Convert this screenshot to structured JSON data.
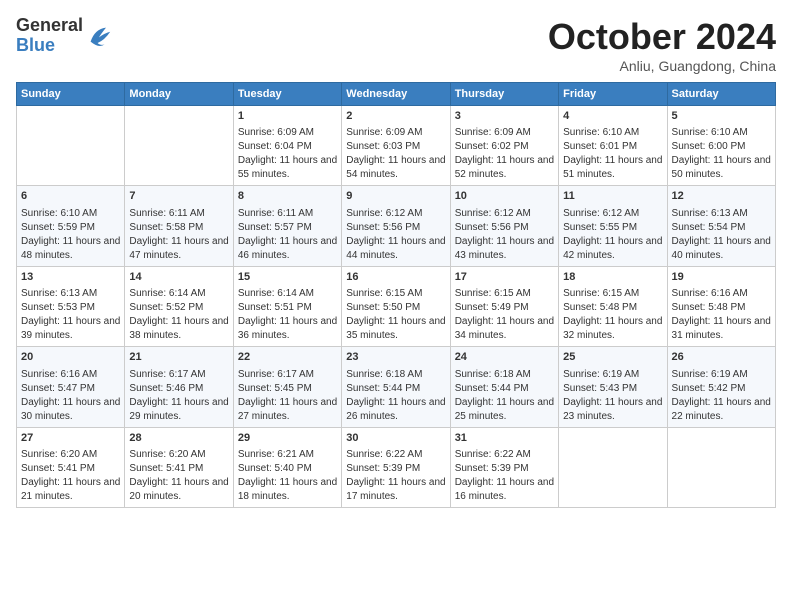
{
  "header": {
    "title": "October 2024",
    "location": "Anliu, Guangdong, China",
    "logo_general": "General",
    "logo_blue": "Blue"
  },
  "weekdays": [
    "Sunday",
    "Monday",
    "Tuesday",
    "Wednesday",
    "Thursday",
    "Friday",
    "Saturday"
  ],
  "weeks": [
    [
      {
        "day": "",
        "info": ""
      },
      {
        "day": "",
        "info": ""
      },
      {
        "day": "1",
        "info": "Sunrise: 6:09 AM\nSunset: 6:04 PM\nDaylight: 11 hours and 55 minutes."
      },
      {
        "day": "2",
        "info": "Sunrise: 6:09 AM\nSunset: 6:03 PM\nDaylight: 11 hours and 54 minutes."
      },
      {
        "day": "3",
        "info": "Sunrise: 6:09 AM\nSunset: 6:02 PM\nDaylight: 11 hours and 52 minutes."
      },
      {
        "day": "4",
        "info": "Sunrise: 6:10 AM\nSunset: 6:01 PM\nDaylight: 11 hours and 51 minutes."
      },
      {
        "day": "5",
        "info": "Sunrise: 6:10 AM\nSunset: 6:00 PM\nDaylight: 11 hours and 50 minutes."
      }
    ],
    [
      {
        "day": "6",
        "info": "Sunrise: 6:10 AM\nSunset: 5:59 PM\nDaylight: 11 hours and 48 minutes."
      },
      {
        "day": "7",
        "info": "Sunrise: 6:11 AM\nSunset: 5:58 PM\nDaylight: 11 hours and 47 minutes."
      },
      {
        "day": "8",
        "info": "Sunrise: 6:11 AM\nSunset: 5:57 PM\nDaylight: 11 hours and 46 minutes."
      },
      {
        "day": "9",
        "info": "Sunrise: 6:12 AM\nSunset: 5:56 PM\nDaylight: 11 hours and 44 minutes."
      },
      {
        "day": "10",
        "info": "Sunrise: 6:12 AM\nSunset: 5:56 PM\nDaylight: 11 hours and 43 minutes."
      },
      {
        "day": "11",
        "info": "Sunrise: 6:12 AM\nSunset: 5:55 PM\nDaylight: 11 hours and 42 minutes."
      },
      {
        "day": "12",
        "info": "Sunrise: 6:13 AM\nSunset: 5:54 PM\nDaylight: 11 hours and 40 minutes."
      }
    ],
    [
      {
        "day": "13",
        "info": "Sunrise: 6:13 AM\nSunset: 5:53 PM\nDaylight: 11 hours and 39 minutes."
      },
      {
        "day": "14",
        "info": "Sunrise: 6:14 AM\nSunset: 5:52 PM\nDaylight: 11 hours and 38 minutes."
      },
      {
        "day": "15",
        "info": "Sunrise: 6:14 AM\nSunset: 5:51 PM\nDaylight: 11 hours and 36 minutes."
      },
      {
        "day": "16",
        "info": "Sunrise: 6:15 AM\nSunset: 5:50 PM\nDaylight: 11 hours and 35 minutes."
      },
      {
        "day": "17",
        "info": "Sunrise: 6:15 AM\nSunset: 5:49 PM\nDaylight: 11 hours and 34 minutes."
      },
      {
        "day": "18",
        "info": "Sunrise: 6:15 AM\nSunset: 5:48 PM\nDaylight: 11 hours and 32 minutes."
      },
      {
        "day": "19",
        "info": "Sunrise: 6:16 AM\nSunset: 5:48 PM\nDaylight: 11 hours and 31 minutes."
      }
    ],
    [
      {
        "day": "20",
        "info": "Sunrise: 6:16 AM\nSunset: 5:47 PM\nDaylight: 11 hours and 30 minutes."
      },
      {
        "day": "21",
        "info": "Sunrise: 6:17 AM\nSunset: 5:46 PM\nDaylight: 11 hours and 29 minutes."
      },
      {
        "day": "22",
        "info": "Sunrise: 6:17 AM\nSunset: 5:45 PM\nDaylight: 11 hours and 27 minutes."
      },
      {
        "day": "23",
        "info": "Sunrise: 6:18 AM\nSunset: 5:44 PM\nDaylight: 11 hours and 26 minutes."
      },
      {
        "day": "24",
        "info": "Sunrise: 6:18 AM\nSunset: 5:44 PM\nDaylight: 11 hours and 25 minutes."
      },
      {
        "day": "25",
        "info": "Sunrise: 6:19 AM\nSunset: 5:43 PM\nDaylight: 11 hours and 23 minutes."
      },
      {
        "day": "26",
        "info": "Sunrise: 6:19 AM\nSunset: 5:42 PM\nDaylight: 11 hours and 22 minutes."
      }
    ],
    [
      {
        "day": "27",
        "info": "Sunrise: 6:20 AM\nSunset: 5:41 PM\nDaylight: 11 hours and 21 minutes."
      },
      {
        "day": "28",
        "info": "Sunrise: 6:20 AM\nSunset: 5:41 PM\nDaylight: 11 hours and 20 minutes."
      },
      {
        "day": "29",
        "info": "Sunrise: 6:21 AM\nSunset: 5:40 PM\nDaylight: 11 hours and 18 minutes."
      },
      {
        "day": "30",
        "info": "Sunrise: 6:22 AM\nSunset: 5:39 PM\nDaylight: 11 hours and 17 minutes."
      },
      {
        "day": "31",
        "info": "Sunrise: 6:22 AM\nSunset: 5:39 PM\nDaylight: 11 hours and 16 minutes."
      },
      {
        "day": "",
        "info": ""
      },
      {
        "day": "",
        "info": ""
      }
    ]
  ]
}
